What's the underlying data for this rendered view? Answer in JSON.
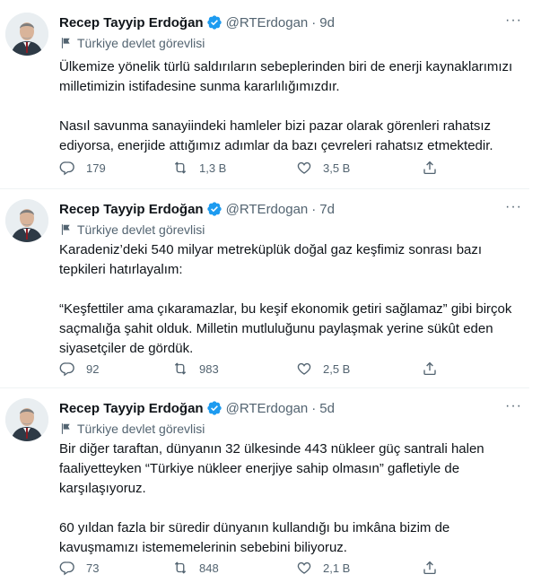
{
  "tweets": [
    {
      "name": "Recep Tayyip Erdoğan",
      "handle": "@RTErdogan",
      "dot": "·",
      "time": "9d",
      "label": "Türkiye devlet görevlisi",
      "paragraphs": [
        "Ülkemize yönelik türlü saldırıların sebeplerinden biri de enerji kaynaklarımızı milletimizin istifadesine sunma kararlılığımızdır.",
        "Nasıl savunma sanayiindeki hamleler bizi pazar olarak görenleri rahatsız ediyorsa, enerjide attığımız adımlar da bazı çevreleri rahatsız etmektedir."
      ],
      "replies": "179",
      "retweets": "1,3 B",
      "likes": "3,5 B"
    },
    {
      "name": "Recep Tayyip Erdoğan",
      "handle": "@RTErdogan",
      "dot": "·",
      "time": "7d",
      "label": "Türkiye devlet görevlisi",
      "paragraphs": [
        "Karadeniz’deki 540 milyar metreküplük doğal gaz keşfimiz sonrası bazı tepkileri hatırlayalım:",
        "“Keşfettiler ama çıkaramazlar, bu keşif ekonomik getiri sağlamaz” gibi birçok saçmalığa şahit olduk. Milletin mutluluğunu paylaşmak yerine sükût eden siyasetçiler de gördük."
      ],
      "replies": "92",
      "retweets": "983",
      "likes": "2,5 B"
    },
    {
      "name": "Recep Tayyip Erdoğan",
      "handle": "@RTErdogan",
      "dot": "·",
      "time": "5d",
      "label": "Türkiye devlet görevlisi",
      "paragraphs": [
        "Bir diğer taraftan, dünyanın 32 ülkesinde 443 nükleer güç santrali halen faaliyetteyken “Türkiye nükleer enerjiye sahip olmasın” gafletiyle de karşılaşıyoruz.",
        "60 yıldan fazla bir süredir dünyanın kullandığı bu imkâna bizim de kavuşmamızı istememelerinin sebebini biliyoruz."
      ],
      "replies": "73",
      "retweets": "848",
      "likes": "2,1 B"
    }
  ],
  "more_glyph": "···",
  "icons": {
    "verified": "verified-badge-icon",
    "label": "flag-icon",
    "reply": "reply-icon",
    "retweet": "retweet-icon",
    "like": "heart-icon",
    "share": "share-icon"
  },
  "colors": {
    "verified": "#1d9bf0",
    "muted": "#536471",
    "text": "#0f1419"
  }
}
